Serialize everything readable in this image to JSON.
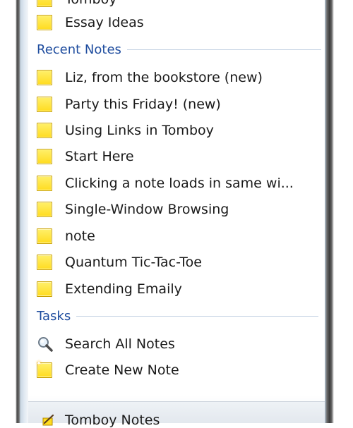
{
  "notebook_items": [
    {
      "label": "Tomboy"
    },
    {
      "label": "Essay Ideas"
    }
  ],
  "recent": {
    "title": "Recent Notes",
    "items": [
      {
        "label": "Liz, from the bookstore (new)"
      },
      {
        "label": "Party this Friday! (new)"
      },
      {
        "label": "Using Links in Tomboy"
      },
      {
        "label": "Start Here"
      },
      {
        "label": "Clicking a note loads in same wi..."
      },
      {
        "label": "Single-Window Browsing"
      },
      {
        "label": "note"
      },
      {
        "label": "Quantum Tic-Tac-Toe"
      },
      {
        "label": "Extending Emaily"
      }
    ]
  },
  "tasks": {
    "title": "Tasks",
    "search_label": "Search All Notes",
    "create_label": "Create New Note"
  },
  "footer": {
    "label": "Tomboy Notes"
  },
  "colors": {
    "section_title": "#1e4c9e",
    "note_icon": "#ffdc1f"
  },
  "icons": {
    "note": "note-icon",
    "search": "search-icon",
    "new_note": "new-note-icon",
    "footer": "tomboy-app-icon"
  }
}
